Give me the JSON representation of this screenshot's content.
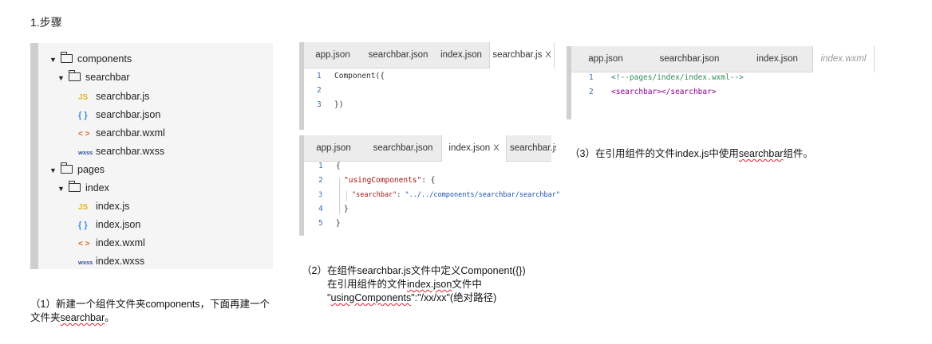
{
  "heading": "1.步骤",
  "tree": {
    "items": [
      {
        "kind": "folder",
        "label": "components"
      },
      {
        "kind": "folder",
        "label": "searchbar"
      },
      {
        "kind": "js",
        "icon": "JS",
        "label": "searchbar.js"
      },
      {
        "kind": "json",
        "icon": "{ }",
        "label": "searchbar.json"
      },
      {
        "kind": "wxml",
        "icon": "< >",
        "label": "searchbar.wxml"
      },
      {
        "kind": "wxss",
        "icon": "wxss",
        "label": "searchbar.wxss"
      },
      {
        "kind": "folder",
        "label": "pages"
      },
      {
        "kind": "folder",
        "label": "index"
      },
      {
        "kind": "js",
        "icon": "JS",
        "label": "index.js"
      },
      {
        "kind": "json",
        "icon": "{ }",
        "label": "index.json"
      },
      {
        "kind": "wxml",
        "icon": "< >",
        "label": "index.wxml"
      },
      {
        "kind": "wxss",
        "icon": "wxss",
        "label": "index.wxss"
      }
    ]
  },
  "editor1": {
    "tabs": [
      "app.json",
      "searchbar.json",
      "index.json",
      "searchbar.js"
    ],
    "active_tab_close": "X",
    "lines": [
      {
        "n": "1",
        "text": "Component({"
      },
      {
        "n": "2",
        "text": ""
      },
      {
        "n": "3",
        "text": "})"
      }
    ]
  },
  "editor2": {
    "tabs": [
      "app.json",
      "searchbar.json",
      "index.json",
      "searchbar.js"
    ],
    "active_tab_close": "X",
    "lines": [
      {
        "n": "1",
        "text": "{"
      },
      {
        "n": "2",
        "key": "\"usingComponents\"",
        "rest": ": {"
      },
      {
        "n": "3",
        "key": "\"searchbar\"",
        "mid": ": ",
        "val": "\"../../components/searchbar/searchbar\""
      },
      {
        "n": "4",
        "text": "}"
      },
      {
        "n": "5",
        "text": "}"
      }
    ]
  },
  "editor3": {
    "tabs": [
      "app.json",
      "searchbar.json",
      "index.json",
      "index.wxml"
    ],
    "lines": [
      {
        "n": "1",
        "text": "<!--pages/index/index.wxml-->"
      },
      {
        "n": "2",
        "text": "<searchbar></searchbar>"
      }
    ]
  },
  "captions": {
    "step1_line1": "（1）新建一个组件文件夹components，下面再建一个",
    "step1_line2_pre": "文件夹",
    "step1_line2_word": "searchbar",
    "step1_line2_post": "。",
    "step2_line1": "（2）在组件searchbar.js文件中定义Component({})",
    "step2_line2_pre": "在引用组件的文件",
    "step2_line2_word": "index.json",
    "step2_line2_post": "文件中",
    "step2_line3_q": "\"",
    "step2_line3_word": "usingComponents",
    "step2_line3_post": "\":\"/xx/xx\"(绝对路径)",
    "step3_pre": "（3）在引用组件的文件index.js中使用",
    "step3_word": "searchbar",
    "step3_post": "组件。"
  }
}
